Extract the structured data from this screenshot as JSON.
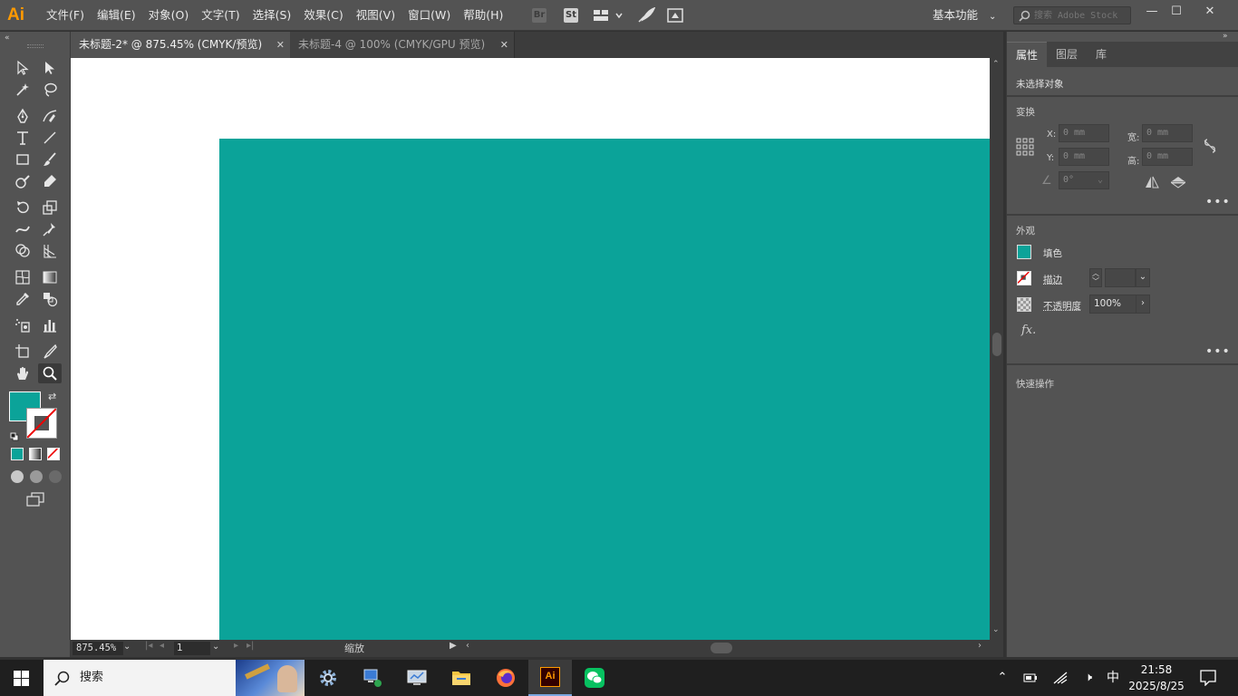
{
  "app": {
    "logo": "Ai"
  },
  "menu": [
    "文件(F)",
    "编辑(E)",
    "对象(O)",
    "文字(T)",
    "选择(S)",
    "效果(C)",
    "视图(V)",
    "窗口(W)",
    "帮助(H)"
  ],
  "toolbar_icons": {
    "br": "Br",
    "st": "St"
  },
  "workspace": "基本功能",
  "stock_search": {
    "placeholder": "搜索 Adobe Stock"
  },
  "window_controls": {
    "minimize": "—",
    "maximize": "☐",
    "close": "✕"
  },
  "tabs": [
    {
      "label": "未标题-2* @ 875.45% (CMYK/预览)",
      "close": "✕"
    },
    {
      "label": "未标题-4 @ 100% (CMYK/GPU 预览)",
      "close": "✕"
    }
  ],
  "statusbar": {
    "zoom": "875.45%",
    "page": "1",
    "label": "缩放"
  },
  "right_panel": {
    "tabs": [
      "属性",
      "图层",
      "库"
    ],
    "no_selection": "未选择对象",
    "transform": {
      "title": "变换",
      "x_label": "X:",
      "x_value": "0 mm",
      "y_label": "Y:",
      "y_value": "0 mm",
      "w_label": "宽:",
      "w_value": "0 mm",
      "h_label": "高:",
      "h_value": "0 mm",
      "angle_value": "0°"
    },
    "appearance": {
      "title": "外观",
      "fill_label": "填色",
      "stroke_label": "描边",
      "opacity_label": "不透明度",
      "opacity_value": "100%",
      "fx_label": "fx."
    },
    "quick_actions": "快速操作",
    "more": "•••"
  },
  "colors": {
    "fill": "#0ba399",
    "canvas": "#ffffff",
    "ui_bg": "#535353"
  },
  "taskbar": {
    "search_text": "搜索",
    "clock_time": "21:58",
    "clock_date": "2025/8/25",
    "ime": "中"
  }
}
